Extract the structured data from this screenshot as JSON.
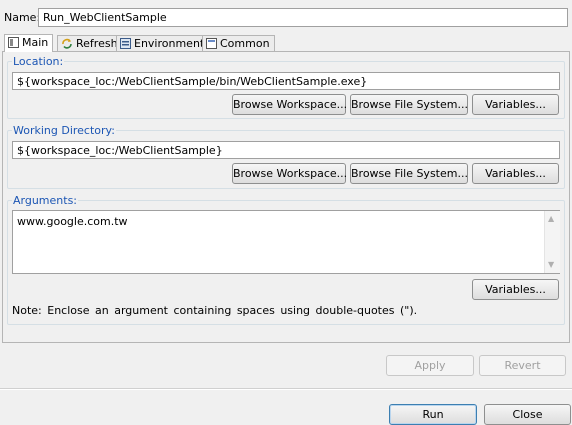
{
  "name_label": "Name:",
  "name_value": "Run_WebClientSample",
  "tabs": [
    {
      "label": "Main",
      "icon": "main-tab-icon"
    },
    {
      "label": "Refresh",
      "icon": "refresh-icon"
    },
    {
      "label": "Environment",
      "icon": "environment-icon"
    },
    {
      "label": "Common",
      "icon": "common-tab-icon"
    }
  ],
  "location": {
    "label": "Location:",
    "value": "${workspace_loc:/WebClientSample/bin/WebClientSample.exe}",
    "buttons": [
      "Browse Workspace...",
      "Browse File System...",
      "Variables..."
    ]
  },
  "working_dir": {
    "label": "Working Directory:",
    "value": "${workspace_loc:/WebClientSample}",
    "buttons": [
      "Browse Workspace...",
      "Browse File System...",
      "Variables..."
    ]
  },
  "arguments": {
    "label": "Arguments:",
    "value": "www.google.com.tw",
    "variables_button": "Variables...",
    "note": "Note: Enclose an argument containing spaces using double-quotes (\")."
  },
  "actions": {
    "apply": "Apply",
    "revert": "Revert",
    "run": "Run",
    "close": "Close"
  }
}
